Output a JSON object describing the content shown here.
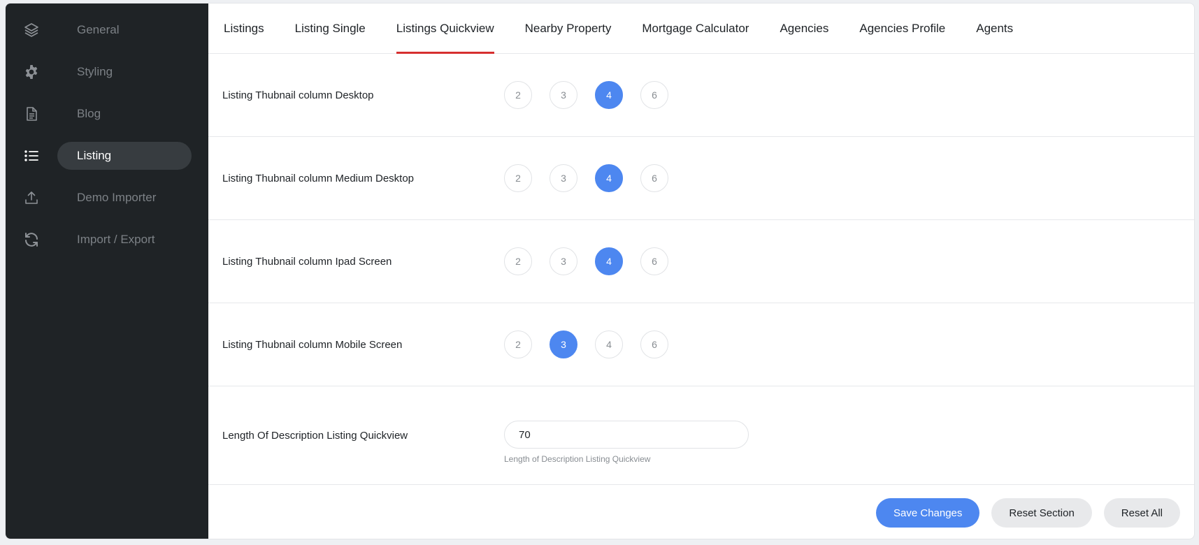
{
  "sidebar": {
    "items": [
      {
        "label": "General",
        "icon": "layers-icon"
      },
      {
        "label": "Styling",
        "icon": "gear-icon"
      },
      {
        "label": "Blog",
        "icon": "document-icon"
      },
      {
        "label": "Listing",
        "icon": "list-icon",
        "active": true
      },
      {
        "label": "Demo Importer",
        "icon": "upload-icon"
      },
      {
        "label": "Import / Export",
        "icon": "refresh-icon"
      }
    ]
  },
  "tabs": [
    {
      "label": "Listings"
    },
    {
      "label": "Listing Single"
    },
    {
      "label": "Listings Quickview",
      "active": true
    },
    {
      "label": "Nearby Property"
    },
    {
      "label": "Mortgage Calculator"
    },
    {
      "label": "Agencies"
    },
    {
      "label": "Agencies Profile"
    },
    {
      "label": "Agents"
    }
  ],
  "settings": {
    "desktop": {
      "label": "Listing Thubnail column Desktop",
      "options": [
        "2",
        "3",
        "4",
        "6"
      ],
      "selected": "4"
    },
    "medium": {
      "label": "Listing Thubnail column Medium Desktop",
      "options": [
        "2",
        "3",
        "4",
        "6"
      ],
      "selected": "4"
    },
    "ipad": {
      "label": "Listing Thubnail column Ipad Screen",
      "options": [
        "2",
        "3",
        "4",
        "6"
      ],
      "selected": "4"
    },
    "mobile": {
      "label": "Listing Thubnail column Mobile Screen",
      "options": [
        "2",
        "3",
        "4",
        "6"
      ],
      "selected": "3"
    },
    "description": {
      "label": "Length Of Description Listing Quickview",
      "value": "70",
      "hint": "Length of Description Listing Quickview"
    }
  },
  "footer": {
    "save_label": "Save Changes",
    "reset_section_label": "Reset Section",
    "reset_all_label": "Reset All"
  },
  "colors": {
    "accent": "#4d87f0",
    "tab_indicator": "#d62f2f",
    "sidebar_bg": "#1f2326"
  }
}
